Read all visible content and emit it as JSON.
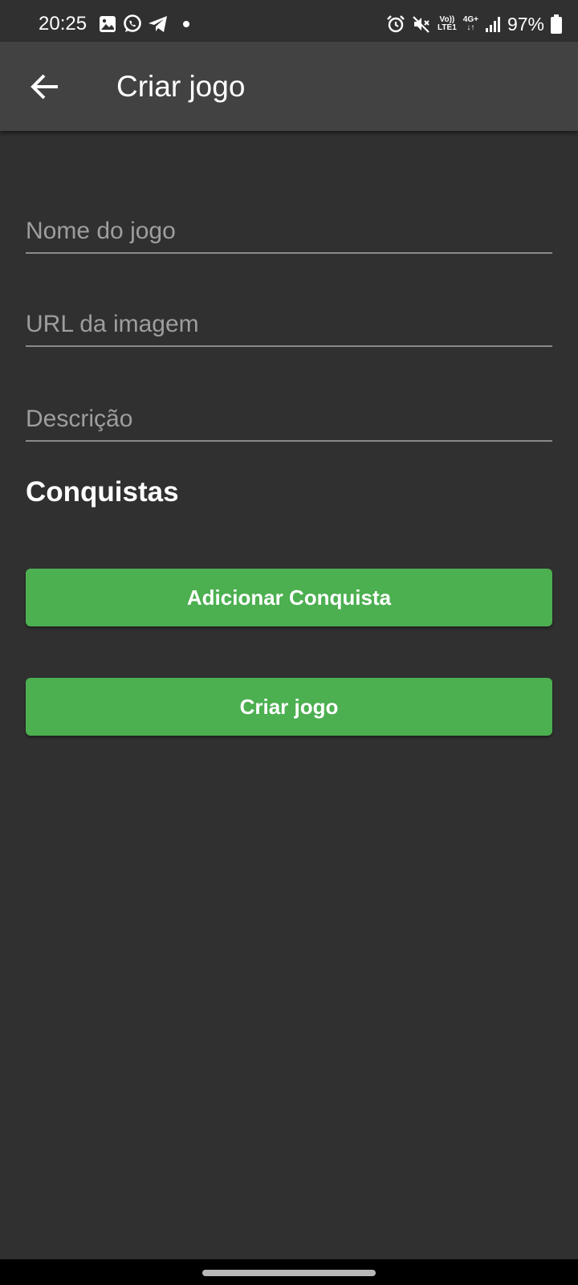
{
  "status_bar": {
    "time": "20:25",
    "left_icons": [
      "gallery-icon",
      "whatsapp-icon",
      "telegram-icon"
    ],
    "right_icons": [
      "alarm-icon",
      "mute-icon",
      "volte-icon",
      "data-4g-icon",
      "signal-icon",
      "battery-icon"
    ],
    "volte_label_top": "Vo))",
    "volte_label_bottom": "LTE1",
    "network_label_top": "4G+",
    "network_label_bottom": "↓↑",
    "battery": "97%"
  },
  "app_bar": {
    "title": "Criar jogo",
    "back_icon": "arrow-back-icon"
  },
  "form": {
    "name_placeholder": "Nome do jogo",
    "image_url_placeholder": "URL da imagem",
    "description_placeholder": "Descrição"
  },
  "achievements": {
    "title": "Conquistas",
    "add_button_label": "Adicionar Conquista"
  },
  "submit_button_label": "Criar jogo",
  "colors": {
    "background": "#303030",
    "app_bar": "#424242",
    "accent": "#4caf50",
    "text_primary": "#ffffff",
    "hint": "#9e9e9e"
  }
}
